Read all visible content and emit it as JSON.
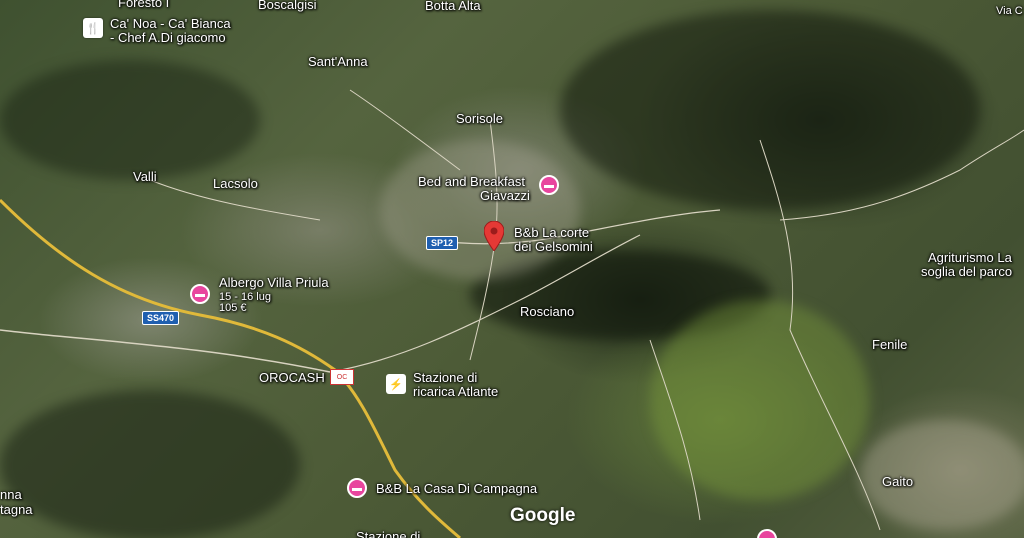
{
  "map": {
    "places": {
      "foresto": "Foresto I",
      "boscalgisi": "Boscalgisi",
      "botta_alta": "Botta Alta",
      "via": "Via C",
      "santanna": "Sant'Anna",
      "sorisole": "Sorisole",
      "valli": "Valli",
      "lacsolo": "Lacsolo",
      "rosciano": "Rosciano",
      "fenile": "Fenile",
      "gaito": "Gaito",
      "anna": "nna",
      "tagna": "tagna"
    },
    "pois": {
      "canoa_line1": "Ca' Noa - Ca' Bianca",
      "canoa_line2": "- Chef A.Di giacomo",
      "bb_giavazzi_line1": "Bed and Breakfast",
      "bb_giavazzi_line2": "Giavazzi",
      "corte_line1": "B&b La corte",
      "corte_line2": "dei Gelsomini",
      "agriturismo_line1": "Agriturismo La",
      "agriturismo_line2": "soglia del parco",
      "albergo_name": "Albergo Villa Priula",
      "albergo_dates": "15 - 16 lug",
      "albergo_price": "105 €",
      "orocash": "OROCASH",
      "stazione_line1": "Stazione di",
      "stazione_line2": "ricarica Atlante",
      "casa_campagna": "B&B La Casa Di Campagna",
      "stazione_bottom": "Stazione di"
    },
    "roads": {
      "sp12": "SP12",
      "ss470": "SS470"
    },
    "attribution": "Google",
    "icons": {
      "hotel": "bed-icon",
      "restaurant": "restaurant-icon",
      "pin": "location-pin-icon",
      "charging": "ev-charging-icon"
    },
    "colors": {
      "hotel_pin": "#e8459e",
      "location_pin": "#e53935",
      "road": "#e0b93a"
    }
  }
}
